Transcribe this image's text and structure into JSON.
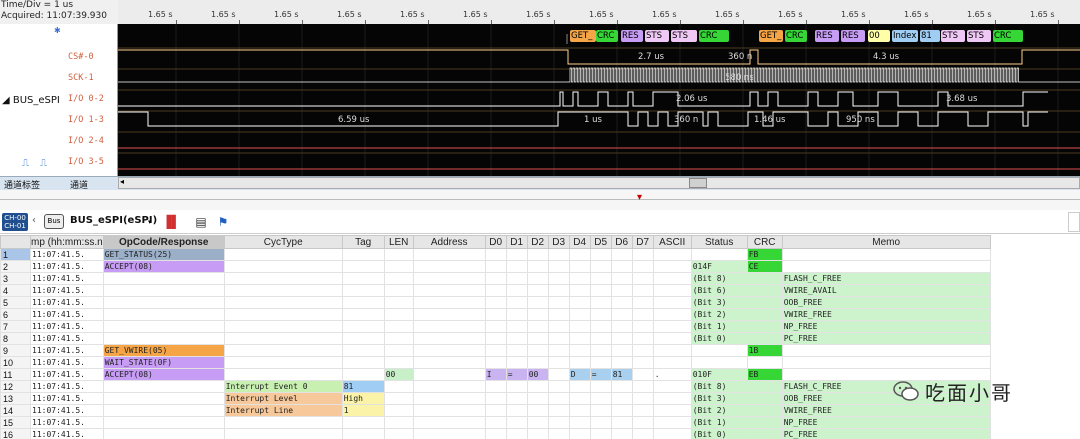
{
  "info": {
    "time_div": "Time/Div = 1 us",
    "acquired": "Acquired: 11:07:39.930"
  },
  "ruler_label": "1.65 s",
  "channel_panel": {
    "bus_name": "BUS_eSPI",
    "channels": [
      "CS#-0",
      "SCK-1",
      "I/O 0-2",
      "I/O 1-3",
      "I/O 2-4",
      "I/O 3-5"
    ],
    "bottom_left": "通道标签",
    "bottom_left2": "通道"
  },
  "decode_cells": [
    "GET_",
    "CRC",
    "RES",
    "STS",
    "STS",
    "CRC",
    "GET_",
    "CRC",
    "RES",
    "RES",
    "00",
    "Index",
    "81",
    "STS",
    "STS",
    "CRC"
  ],
  "wave_texts": {
    "cs_1": "2.7 us",
    "cs_2": "360 n",
    "cs_3": "4.3 us",
    "sck_1": "580 ns",
    "io0_1": "2.06 us",
    "io0_2": "3.68 us",
    "io1_1": "6.59 us",
    "io1_2": "1 us",
    "io1_3": "360 n",
    "io1_4": "1.46 us",
    "io1_5": "950 ns"
  },
  "toolbar": {
    "ch_badge_top": "CH-00",
    "ch_badge_bottom": "CH-01",
    "bus_button": "Bus",
    "title": "BUS_eSPI(eSPI)"
  },
  "table": {
    "headers": [
      "",
      "mp (hh:mm:ss.n",
      "OpCode/Response",
      "CycType",
      "Tag",
      "LEN",
      "Address",
      "D0",
      "D1",
      "D2",
      "D3",
      "D4",
      "D5",
      "D6",
      "D7",
      "ASCII",
      "Status",
      "CRC",
      "Memo"
    ],
    "rows": [
      {
        "n": "1",
        "ts": "11:07:41.5.",
        "op": "GET_STATUS(25)",
        "op_c": "status",
        "cyc": "",
        "tag": "",
        "len": "",
        "addr": "",
        "d": [
          "",
          "",
          "",
          "",
          "",
          "",
          "",
          ""
        ],
        "ascii": "",
        "status": "",
        "crc": "FB",
        "memo": ""
      },
      {
        "n": "2",
        "ts": "11:07:41.5.",
        "op": "ACCEPT(08)",
        "op_c": "accept",
        "cyc": "",
        "tag": "",
        "len": "",
        "addr": "",
        "d": [
          "",
          "",
          "",
          "",
          "",
          "",
          "",
          ""
        ],
        "ascii": "",
        "status": "014F",
        "crc": "CE",
        "memo": ""
      },
      {
        "n": "3",
        "ts": "11:07:41.5.",
        "op": "",
        "op_c": "",
        "cyc": "",
        "tag": "",
        "len": "",
        "addr": "",
        "d": [
          "",
          "",
          "",
          "",
          "",
          "",
          "",
          ""
        ],
        "ascii": "",
        "status": "(Bit 8)",
        "crc": "",
        "memo": "FLASH_C_FREE"
      },
      {
        "n": "4",
        "ts": "11:07:41.5.",
        "op": "",
        "op_c": "",
        "cyc": "",
        "tag": "",
        "len": "",
        "addr": "",
        "d": [
          "",
          "",
          "",
          "",
          "",
          "",
          "",
          ""
        ],
        "ascii": "",
        "status": "(Bit 6)",
        "crc": "",
        "memo": "VWIRE_AVAIL"
      },
      {
        "n": "5",
        "ts": "11:07:41.5.",
        "op": "",
        "op_c": "",
        "cyc": "",
        "tag": "",
        "len": "",
        "addr": "",
        "d": [
          "",
          "",
          "",
          "",
          "",
          "",
          "",
          ""
        ],
        "ascii": "",
        "status": "(Bit 3)",
        "crc": "",
        "memo": "OOB_FREE"
      },
      {
        "n": "6",
        "ts": "11:07:41.5.",
        "op": "",
        "op_c": "",
        "cyc": "",
        "tag": "",
        "len": "",
        "addr": "",
        "d": [
          "",
          "",
          "",
          "",
          "",
          "",
          "",
          ""
        ],
        "ascii": "",
        "status": "(Bit 2)",
        "crc": "",
        "memo": "VWIRE_FREE"
      },
      {
        "n": "7",
        "ts": "11:07:41.5.",
        "op": "",
        "op_c": "",
        "cyc": "",
        "tag": "",
        "len": "",
        "addr": "",
        "d": [
          "",
          "",
          "",
          "",
          "",
          "",
          "",
          ""
        ],
        "ascii": "",
        "status": "(Bit 1)",
        "crc": "",
        "memo": "NP_FREE"
      },
      {
        "n": "8",
        "ts": "11:07:41.5.",
        "op": "",
        "op_c": "",
        "cyc": "",
        "tag": "",
        "len": "",
        "addr": "",
        "d": [
          "",
          "",
          "",
          "",
          "",
          "",
          "",
          ""
        ],
        "ascii": "",
        "status": "(Bit 0)",
        "crc": "",
        "memo": "PC_FREE"
      },
      {
        "n": "9",
        "ts": "11:07:41.5.",
        "op": "GET_VWIRE(05)",
        "op_c": "vwire",
        "cyc": "",
        "tag": "",
        "len": "",
        "addr": "",
        "d": [
          "",
          "",
          "",
          "",
          "",
          "",
          "",
          ""
        ],
        "ascii": "",
        "status": "",
        "crc": "1B",
        "memo": ""
      },
      {
        "n": "10",
        "ts": "11:07:41.5.",
        "op": "WAIT_STATE(0F)",
        "op_c": "accept",
        "cyc": "",
        "tag": "",
        "len": "",
        "addr": "",
        "d": [
          "",
          "",
          "",
          "",
          "",
          "",
          "",
          ""
        ],
        "ascii": "",
        "status": "",
        "crc": "",
        "memo": ""
      },
      {
        "n": "11",
        "ts": "11:07:41.5.",
        "op": "ACCEPT(08)",
        "op_c": "accept",
        "cyc": "",
        "tag": "",
        "len": "00",
        "addr": "",
        "d": [
          "I",
          "=",
          "00",
          "",
          "D",
          "=",
          "81",
          ""
        ],
        "ascii": ".",
        "status": "010F",
        "crc": "EB",
        "memo": ""
      },
      {
        "n": "12",
        "ts": "11:07:41.5.",
        "op": "",
        "op_c": "",
        "cyc": "Interrupt Event 0",
        "cyc_c": "int",
        "tag": "81",
        "tag_c": "blue",
        "len": "",
        "addr": "",
        "d": [
          "",
          "",
          "",
          "",
          "",
          "",
          "",
          ""
        ],
        "ascii": "",
        "status": "(Bit 8)",
        "crc": "",
        "memo": "FLASH_C_FREE"
      },
      {
        "n": "13",
        "ts": "11:07:41.5.",
        "op": "",
        "op_c": "",
        "cyc": "Interrupt Level",
        "cyc_c": "level",
        "tag": "High",
        "tag_c": "yellow",
        "len": "",
        "addr": "",
        "d": [
          "",
          "",
          "",
          "",
          "",
          "",
          "",
          ""
        ],
        "ascii": "",
        "status": "(Bit 3)",
        "crc": "",
        "memo": "OOB_FREE"
      },
      {
        "n": "14",
        "ts": "11:07:41.5.",
        "op": "",
        "op_c": "",
        "cyc": "Interrupt Line",
        "cyc_c": "level",
        "tag": "1",
        "tag_c": "yellow",
        "len": "",
        "addr": "",
        "d": [
          "",
          "",
          "",
          "",
          "",
          "",
          "",
          ""
        ],
        "ascii": "",
        "status": "(Bit 2)",
        "crc": "",
        "memo": "VWIRE_FREE"
      },
      {
        "n": "15",
        "ts": "11:07:41.5.",
        "op": "",
        "op_c": "",
        "cyc": "",
        "tag": "",
        "len": "",
        "addr": "",
        "d": [
          "",
          "",
          "",
          "",
          "",
          "",
          "",
          ""
        ],
        "ascii": "",
        "status": "(Bit 1)",
        "crc": "",
        "memo": "NP_FREE"
      },
      {
        "n": "16",
        "ts": "11:07:41.5.",
        "op": "",
        "op_c": "",
        "cyc": "",
        "tag": "",
        "len": "",
        "addr": "",
        "d": [
          "",
          "",
          "",
          "",
          "",
          "",
          "",
          ""
        ],
        "ascii": "",
        "status": "(Bit 0)",
        "crc": "",
        "memo": "PC_FREE"
      }
    ]
  },
  "watermark": "吃面小哥",
  "colors": {
    "status_op": "#9bb0c8",
    "accept_op": "#c69cf5",
    "vwire_op": "#f5a546",
    "crc_green": "#35d635",
    "memo_green": "#ccf3cc",
    "cs_line": "#ffd08a",
    "wave_line": "#ffffff",
    "io_line": "#e05050"
  }
}
